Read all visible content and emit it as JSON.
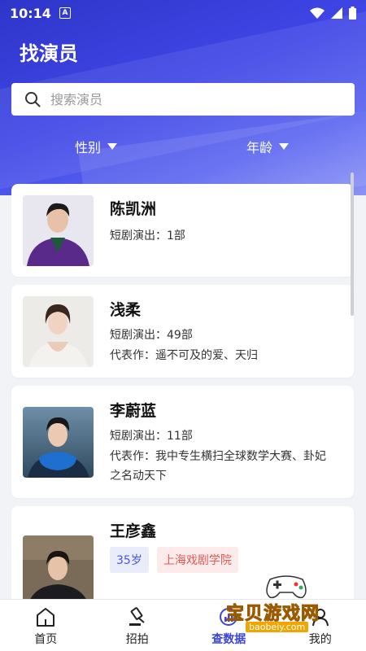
{
  "status_bar": {
    "time": "10:14",
    "notification_icon": "A"
  },
  "header": {
    "title": "找演员"
  },
  "search": {
    "placeholder": "搜索演员",
    "value": ""
  },
  "filters": {
    "gender_label": "性别",
    "age_label": "年龄"
  },
  "actors": [
    {
      "name": "陈凯洲",
      "short_drama": "短剧演出：1部"
    },
    {
      "name": "浅柔",
      "short_drama": "短剧演出：49部",
      "works": "代表作：遥不可及的爱、天归"
    },
    {
      "name": "李蔚蓝",
      "short_drama": "短剧演出：11部",
      "works_line1": "代表作：我中专生横扫全球数学大赛、卦妃",
      "works_line2": "之名动天下"
    },
    {
      "name": "王彦鑫",
      "age_tag": "35岁",
      "school_tag": "上海戏剧学院"
    }
  ],
  "nav": {
    "items": [
      {
        "label": "首页",
        "icon": "home-icon"
      },
      {
        "label": "招拍",
        "icon": "gavel-icon"
      },
      {
        "label": "查数据",
        "icon": "chart-icon",
        "active": true
      },
      {
        "label": "我的",
        "icon": "user-icon"
      }
    ]
  },
  "watermark": {
    "text": "宝贝游戏网",
    "sub": "baobeiy.com"
  },
  "colors": {
    "accent": "#3b45d8",
    "header_start": "#2e35c9",
    "header_end": "#8b93f5"
  }
}
